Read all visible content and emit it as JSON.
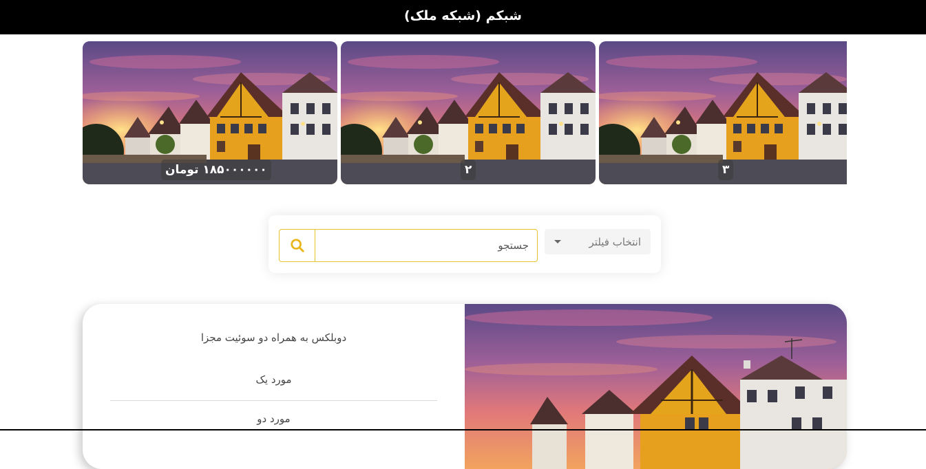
{
  "header": {
    "title": "شبکم (شبکه ملک)"
  },
  "carousel": {
    "slides": [
      {
        "badge": "۱۸۵۰۰۰۰۰۰ تومان"
      },
      {
        "badge": "۲"
      },
      {
        "badge": "۳"
      }
    ]
  },
  "search": {
    "placeholder": "جستجو",
    "filter_label": "انتخاب فیلتر"
  },
  "listing": {
    "title": "دوبلکس به همراه دو سوئیت مجزا",
    "features": [
      "مورد یک",
      "مورد دو"
    ]
  },
  "colors": {
    "header_bg": "#000000",
    "accent": "#e8c330",
    "text": "#444444"
  }
}
